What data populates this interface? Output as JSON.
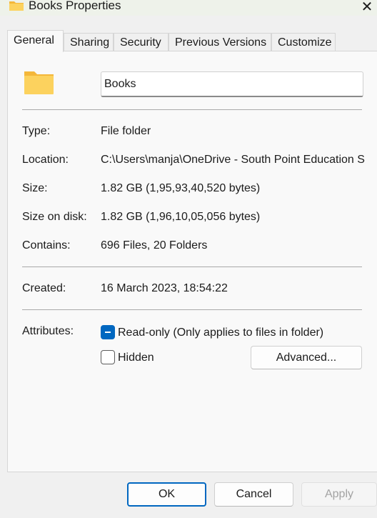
{
  "window": {
    "title": "Books Properties",
    "close_glyph": "✕"
  },
  "tabs": [
    {
      "label": "General",
      "active": true
    },
    {
      "label": "Sharing"
    },
    {
      "label": "Security"
    },
    {
      "label": "Previous Versions"
    },
    {
      "label": "Customize"
    }
  ],
  "general": {
    "folder_name": "Books",
    "icon": "folder-icon",
    "type": {
      "label": "Type:",
      "value": "File folder"
    },
    "location": {
      "label": "Location:",
      "value": "C:\\Users\\manja\\OneDrive - South Point Education Society"
    },
    "size": {
      "label": "Size:",
      "value": "1.82 GB (1,95,93,40,520 bytes)"
    },
    "size_on_disk": {
      "label": "Size on disk:",
      "value": "1.82 GB (1,96,10,05,056 bytes)"
    },
    "contains": {
      "label": "Contains:",
      "value": "696 Files, 20 Folders"
    },
    "created": {
      "label": "Created:",
      "value": "16 March 2023, 18:54:22"
    },
    "attributes": {
      "label": "Attributes:",
      "readonly": {
        "label": "Read-only (Only applies to files in folder)",
        "state": "indeterminate"
      },
      "hidden": {
        "label": "Hidden",
        "checked": false
      },
      "advanced_button": "Advanced..."
    }
  },
  "buttons": {
    "ok": "OK",
    "cancel": "Cancel",
    "apply": "Apply"
  },
  "colors": {
    "accent": "#0067c0",
    "folder": "#f7c948"
  }
}
